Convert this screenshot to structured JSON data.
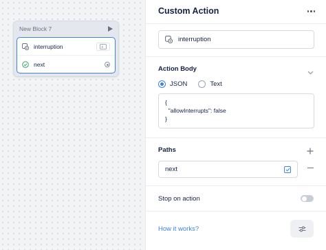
{
  "canvas": {
    "block": {
      "title": "New Block 7",
      "steps": [
        {
          "label": "interruption",
          "icon": "code-icon"
        },
        {
          "label": "next",
          "icon": "check-circle-icon"
        }
      ]
    }
  },
  "panel": {
    "title": "Custom Action",
    "action_name": "interruption",
    "action_body": {
      "label": "Action Body",
      "options": [
        "JSON",
        "Text"
      ],
      "selected": "JSON",
      "code": "{\n  \"allowInterrupts\": false\n}"
    },
    "paths": {
      "label": "Paths",
      "items": [
        "next"
      ]
    },
    "stop_on_action": {
      "label": "Stop on action",
      "enabled": false
    },
    "help_link": "How it works?"
  },
  "colors": {
    "accent": "#3d82e2",
    "text": "#132144"
  }
}
